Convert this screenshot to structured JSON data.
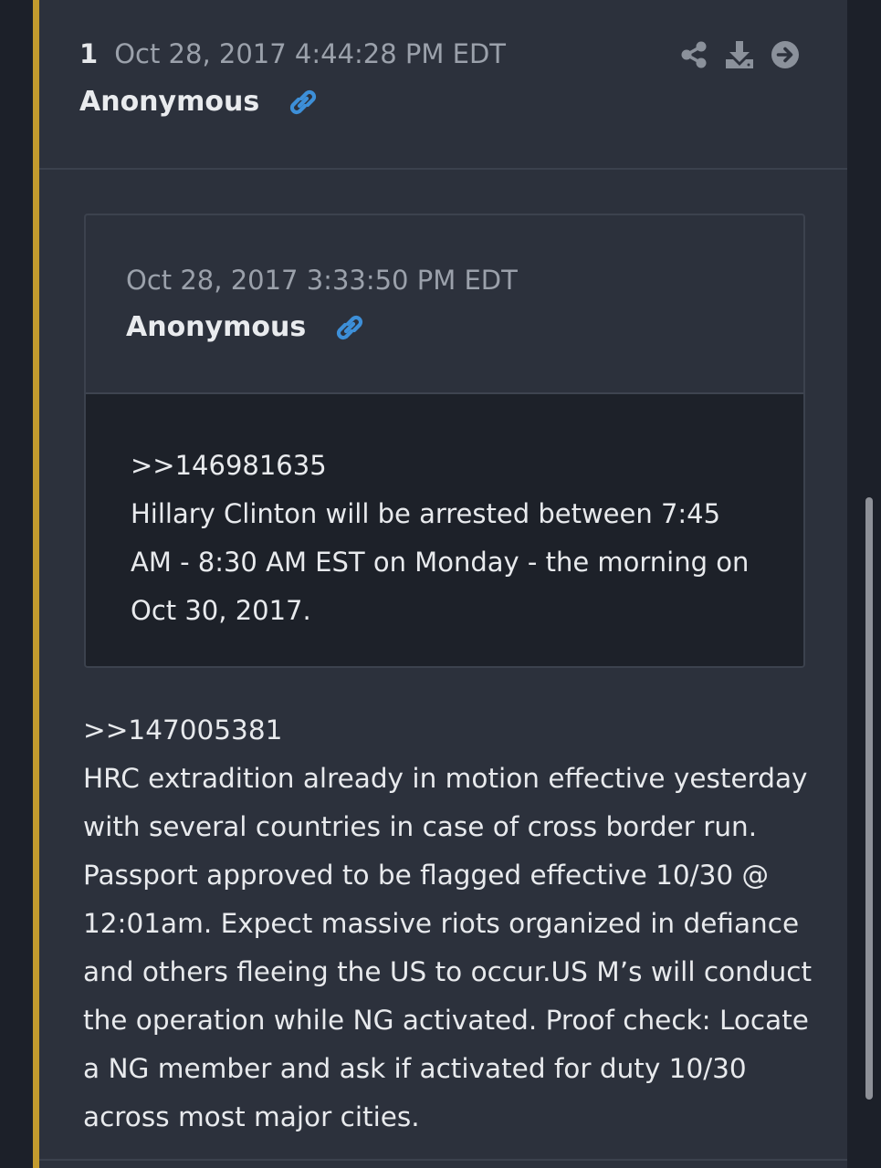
{
  "post": {
    "number": "1",
    "timestamp": "Oct 28, 2017 4:44:28 PM EDT",
    "author": "Anonymous",
    "actions": [
      "share-icon",
      "download-icon",
      "arrow-right-circle-icon"
    ],
    "body_lines": [
      ">>147005381",
      "HRC extradition already in motion effective yesterday",
      "with several countries in case of cross border run.",
      "Passport approved to be flagged effective 10/30 @",
      "12:01am. Expect massive riots organized in defiance",
      "and others fleeing the US to occur.US M’s will conduct",
      "the operation while NG activated. Proof check: Locate",
      "a NG member and ask if activated for duty 10/30",
      "across most major cities."
    ]
  },
  "quote": {
    "timestamp": "Oct 28, 2017 3:33:50 PM EDT",
    "author": "Anonymous",
    "body_lines": [
      ">>146981635",
      "Hillary Clinton will be arrested between 7:45",
      "AM - 8:30 AM EST on Monday - the morning on",
      "Oct 30, 2017."
    ]
  },
  "colors": {
    "accent": "#c39b2e",
    "link_icon": "#3d8fd8",
    "card_bg": "#2c313c",
    "quote_body_bg": "#1d2129"
  }
}
